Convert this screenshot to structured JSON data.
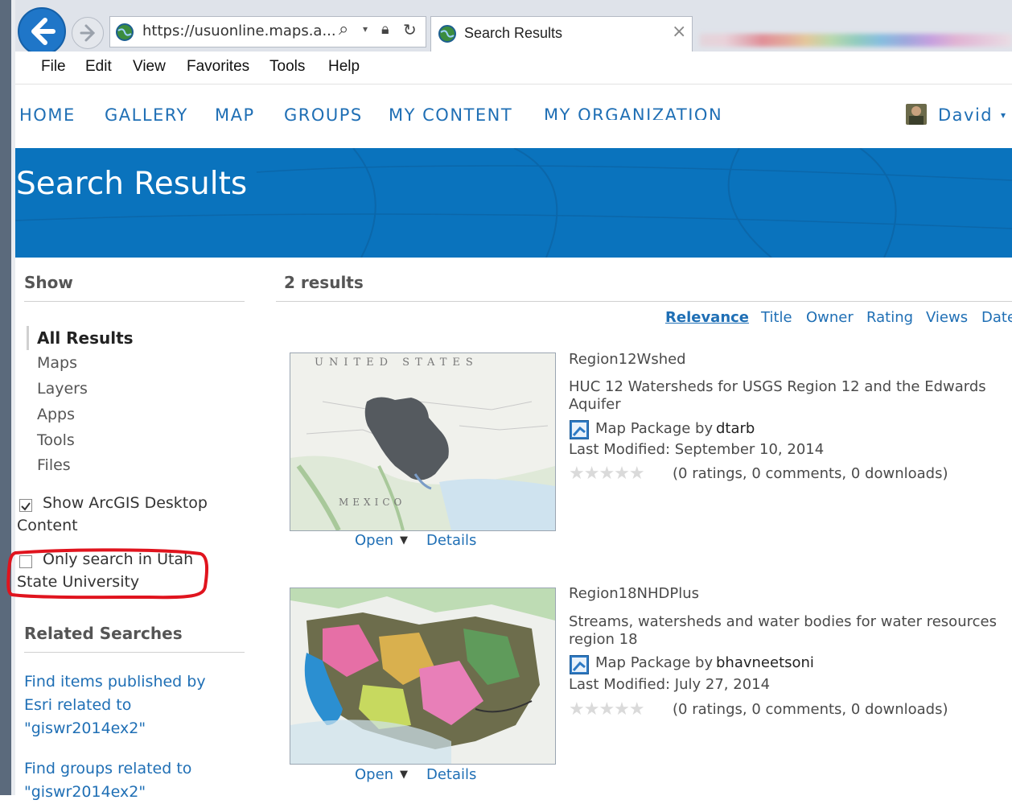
{
  "browser": {
    "url": "https://usuonline.maps.a...",
    "tab_title": "Search Results",
    "tab_close": "×",
    "menu": [
      "File",
      "Edit",
      "View",
      "Favorites",
      "Tools",
      "Help"
    ]
  },
  "nav": {
    "items": [
      "HOME",
      "GALLERY",
      "MAP",
      "GROUPS",
      "MY CONTENT",
      "MY ORGANIZATION"
    ],
    "user": "David"
  },
  "page": {
    "title": "Search Results",
    "results_count": "2 results"
  },
  "sidebar": {
    "show_heading": "Show",
    "filters": [
      "All Results",
      "Maps",
      "Layers",
      "Apps",
      "Tools",
      "Files"
    ],
    "show_desktop": {
      "line1": "Show ArcGIS Desktop",
      "line2": "Content",
      "checked": true
    },
    "only_org": {
      "line1": "Only search in Utah",
      "line2": "State University",
      "checked": false
    },
    "related_heading": "Related Searches",
    "related_links": [
      {
        "lines": [
          "Find items published by",
          "Esri related to",
          "\"giswr2014ex2\""
        ]
      },
      {
        "lines": [
          "Find groups related to",
          "\"giswr2014ex2\""
        ]
      }
    ]
  },
  "sort": [
    "Relevance",
    "Title",
    "Owner",
    "Rating",
    "Views",
    "Date"
  ],
  "results": [
    {
      "name": "Region12Wshed",
      "desc_line1": "HUC 12 Watersheds for USGS Region 12 and the Edwards",
      "desc_line2": "Aquifer",
      "type": "Map Package by",
      "owner": "dtarb",
      "modified": "Last Modified: September 10, 2014",
      "stats": "(0 ratings, 0 comments, 0 downloads)",
      "open": "Open",
      "details": "Details",
      "map_label_top": "UNITED STATES",
      "map_label_bottom": "MEXICO"
    },
    {
      "name": "Region18NHDPlus",
      "desc_line1": "Streams, watersheds and water bodies for water resources",
      "desc_line2": "region 18",
      "type": "Map Package by",
      "owner": "bhavneetsoni",
      "modified": "Last Modified: July 27, 2014",
      "stats": "(0 ratings, 0 comments, 0 downloads)",
      "open": "Open",
      "details": "Details"
    }
  ],
  "colors": {
    "brand_blue": "#0a73bd",
    "link_blue": "#1f6fb5",
    "highlight_red": "#e0141e"
  }
}
